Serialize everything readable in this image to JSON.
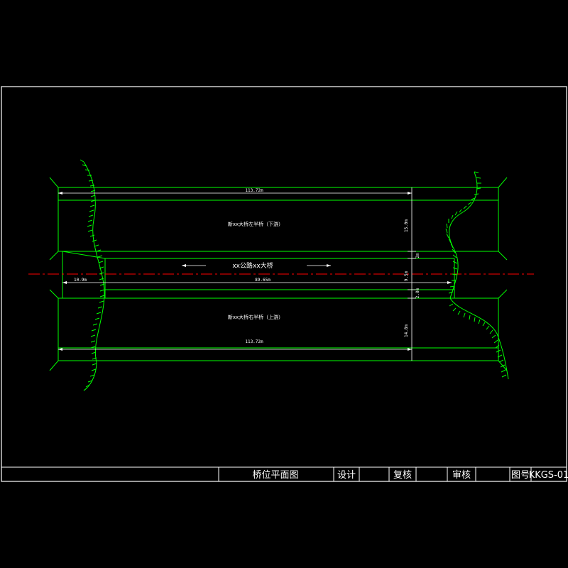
{
  "drawing": {
    "main_bridge_label": "xx公路xx大桥",
    "left_bridge_label": "新xx大桥左半桥（下游）",
    "right_bridge_label": "新xx大桥右半桥（上游）",
    "dims": {
      "left_top_length": "113.72m",
      "left_bottom_length": "113.72m",
      "left_offset": "10.9m",
      "main_length": "89.65m",
      "left_width": "15.0m",
      "left_gap": "2m",
      "main_width": "9.5m",
      "right_gap": "2.0m",
      "right_width": "14.8m"
    }
  },
  "title_block": {
    "title": "桥位平面图",
    "design_label": "设计",
    "review_label": "复核",
    "audit_label": "审核",
    "drawing_no_label": "图号",
    "drawing_no": "KKGS-01"
  },
  "colors": {
    "background": "#000000",
    "frame": "#ffffff",
    "bridge_outline": "#00ff00",
    "centerline": "#ff0000",
    "terrain": "#00ff00",
    "dimension": "#ffffff"
  }
}
